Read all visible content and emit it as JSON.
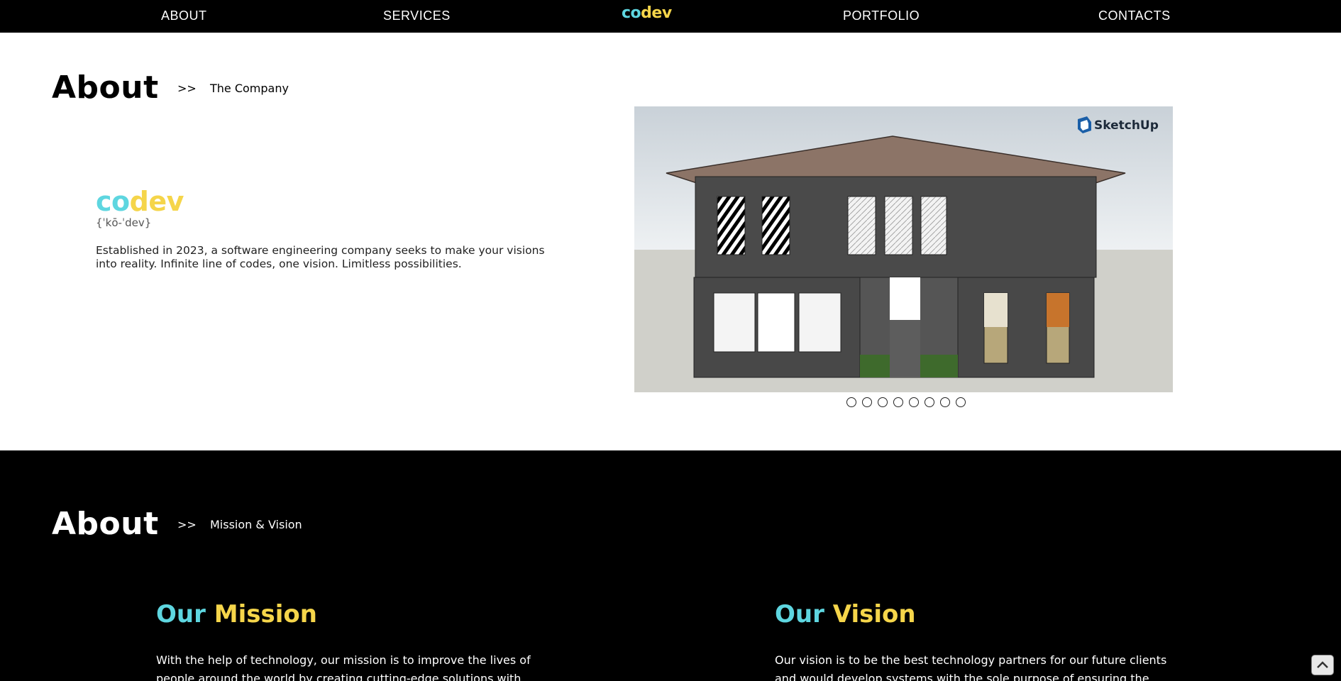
{
  "nav": {
    "items": [
      "ABOUT",
      "SERVICES",
      "PORTFOLIO",
      "CONTACTS"
    ],
    "logo_co": "co",
    "logo_dev": "dev"
  },
  "about_company": {
    "title": "About",
    "arrows": ">>",
    "subtitle": "The Company",
    "brand_co": "co",
    "brand_dev": "dev",
    "phonetic": "{ˈkō-ˈdev}",
    "description": "Established in 2023, a software engineering company seeks to make your visions into reality. Infinite line of codes, one vision. Limitless possibilities.",
    "slide_logo": "SketchUp",
    "slide_count": 8
  },
  "about_mission": {
    "title": "About",
    "arrows": ">>",
    "subtitle": "Mission & Vision",
    "mission_word1": "Our",
    "mission_word2": "Mission",
    "mission_text": "With the help of technology, our mission is to improve the lives of people around the world by creating cutting-edge solutions with",
    "vision_word1": "Our",
    "vision_word2": "Vision",
    "vision_text": "Our vision is to be the best technology partners for our future clients and would develop systems with the sole purpose of ensuring the"
  },
  "colors": {
    "cyan": "#5ed6e0",
    "yellow": "#f5d54a",
    "nav_bg": "#000000"
  },
  "icons": {
    "scroll_top": "chevron-up-icon",
    "sketchup": "sketchup-logo-icon"
  }
}
